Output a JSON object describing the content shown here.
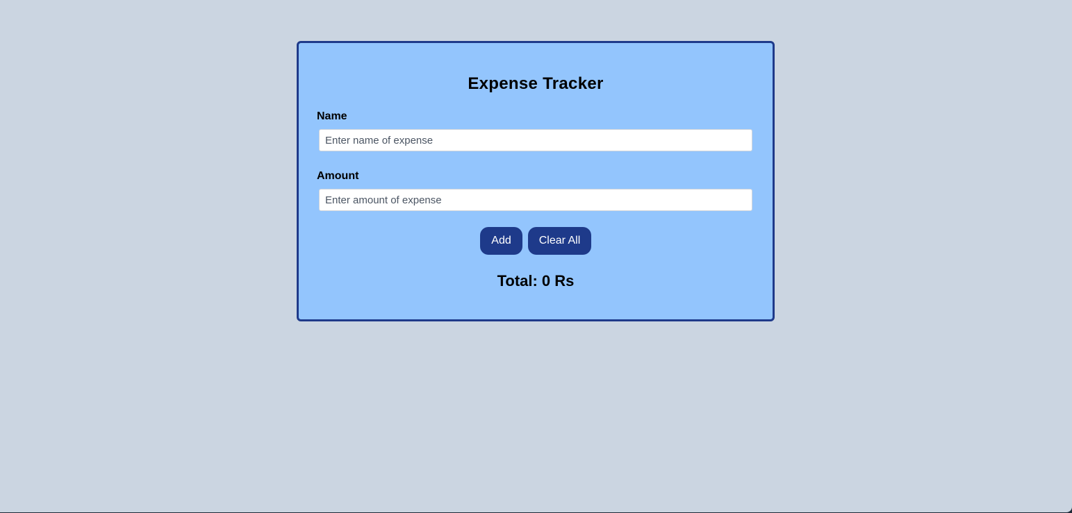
{
  "app": {
    "title": "Expense Tracker"
  },
  "form": {
    "name_label": "Name",
    "name_placeholder": "Enter name of expense",
    "name_value": "",
    "amount_label": "Amount",
    "amount_placeholder": "Enter amount of expense",
    "amount_value": ""
  },
  "actions": {
    "add_label": "Add",
    "clear_label": "Clear All"
  },
  "summary": {
    "total_text": "Total: 0 Rs"
  },
  "colors": {
    "page_background": "#cbd5e1",
    "card_background": "#93c5fd",
    "accent": "#1e3a8a",
    "button_text": "#ffffff"
  }
}
